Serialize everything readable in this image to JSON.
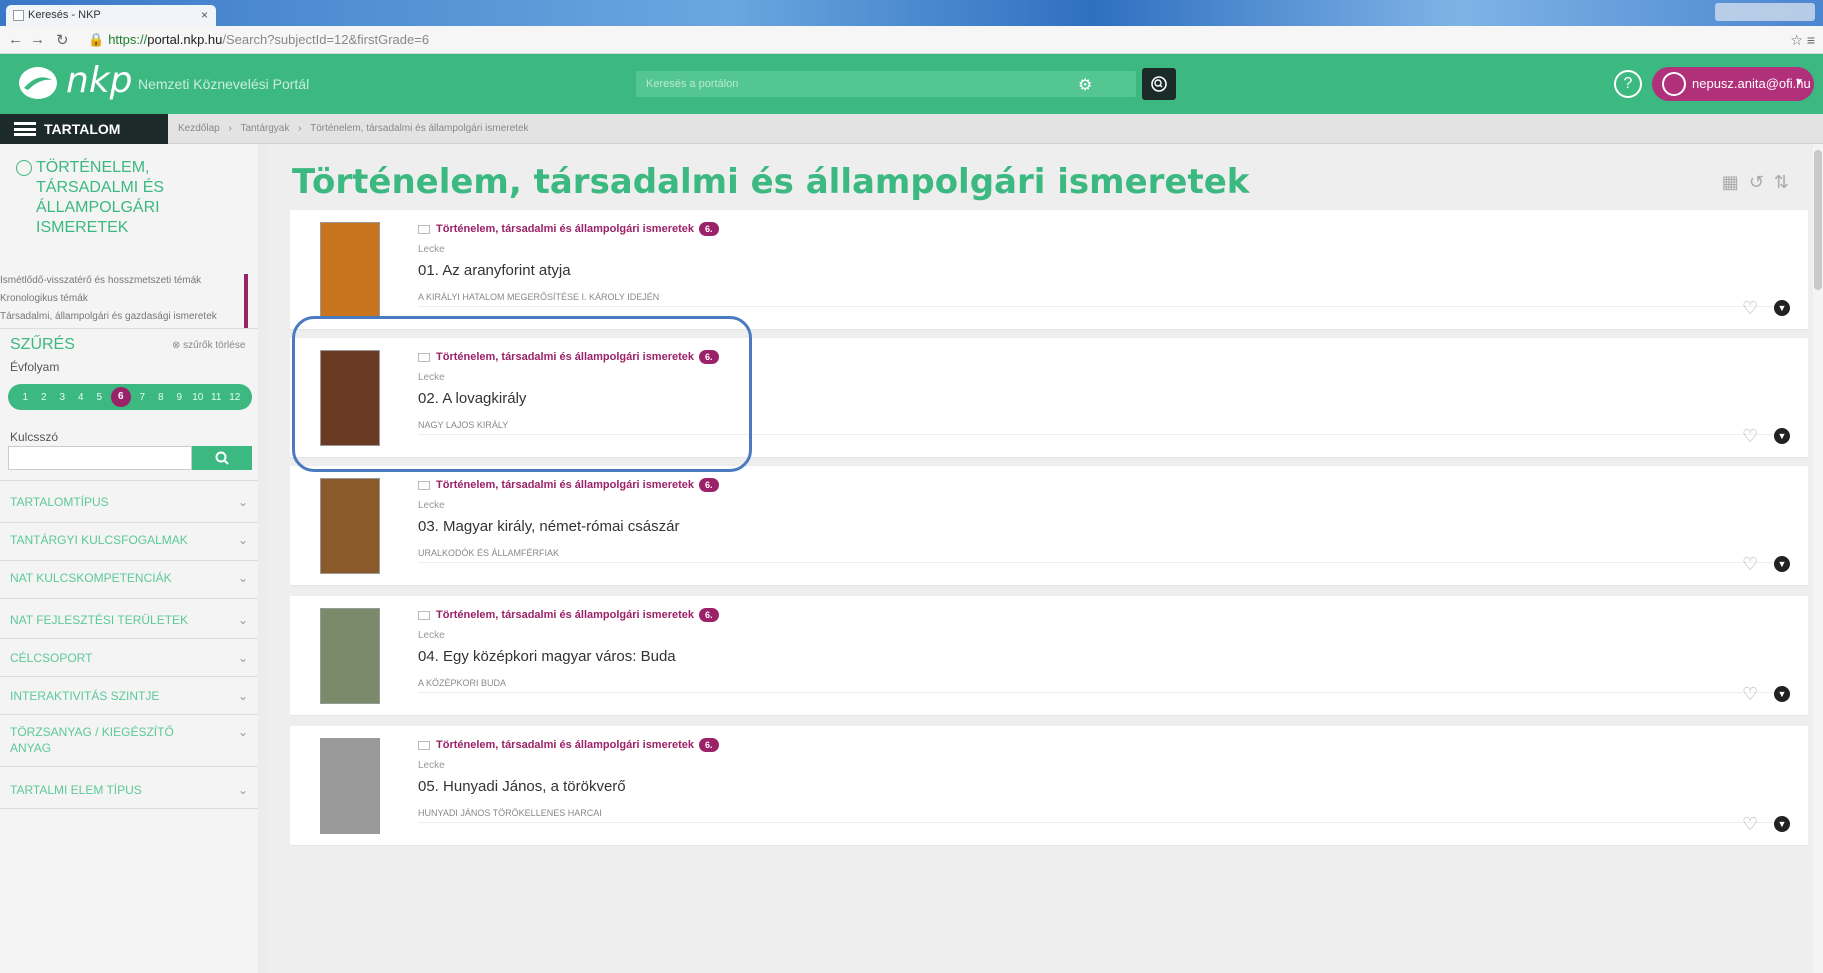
{
  "browser": {
    "tab_title": "Keresés - NKP",
    "tab_close": "×",
    "url_prefix": "https://",
    "url_host": "portal.nkp.hu",
    "url_path": "/Search?subjectId=12&firstGrade=6"
  },
  "header": {
    "logo_text": "nkp",
    "portal_name": "Nemzeti Köznevelési Portál",
    "search_placeholder": "Keresés a portálon",
    "help_symbol": "?",
    "user_email": "nepusz.anita@ofi.hu"
  },
  "menu": {
    "label": "TARTALOM"
  },
  "breadcrumb": [
    "Kezdőlap",
    "›",
    "Tantárgyak",
    "›",
    "Történelem, társadalmi és állampolgári ismeretek"
  ],
  "sidebar": {
    "subject_heading": "Történelem, társadalmi és állampolgári ismeretek",
    "links": [
      "Ismétlődő-visszatérő és hosszmetszeti témák",
      "Kronologikus témák",
      "Társadalmi, állampolgári és gazdasági ismeretek"
    ],
    "filter_title": "SZŰRÉS",
    "filter_clear": "⊗ szűrők törlése",
    "grade_label": "Évfolyam",
    "grades": [
      "1",
      "2",
      "3",
      "4",
      "5",
      "6",
      "7",
      "8",
      "9",
      "10",
      "11",
      "12"
    ],
    "selected_grade": "6",
    "keyword_label": "Kulcsszó",
    "facets": [
      "Tartalomtípus",
      "Tantárgyi kulcsfogalmak",
      "NAT kulcskompetenciák",
      "NAT fejlesztési területek",
      "Célcsoport",
      "Interaktivitás szintje",
      "Törzsanyag / kiegészítő anyag",
      "Tartalmi elem típus"
    ]
  },
  "main": {
    "title": "Történelem, társadalmi és állampolgári ismeretek",
    "cards": [
      {
        "subject": "Történelem, társadalmi és állampolgári ismeretek",
        "grade": "6.",
        "type": "Lecke",
        "title": "01. Az aranyforint atyja",
        "topic": "A királyi hatalom megerősítése I. Károly idején",
        "thumb_color": "#c8741e"
      },
      {
        "subject": "Történelem, társadalmi és állampolgári ismeretek",
        "grade": "6.",
        "type": "Lecke",
        "title": "02. A lovagkirály",
        "topic": "Nagy Lajos király",
        "thumb_color": "#6a3a22"
      },
      {
        "subject": "Történelem, társadalmi és állampolgári ismeretek",
        "grade": "6.",
        "type": "Lecke",
        "title": "03. Magyar király, német-római császár",
        "topic": "Uralkodók és államférfiak",
        "thumb_color": "#8a5a2a"
      },
      {
        "subject": "Történelem, társadalmi és állampolgári ismeretek",
        "grade": "6.",
        "type": "Lecke",
        "title": "04. Egy középkori magyar város: Buda",
        "topic": "A középkori Buda",
        "thumb_color": "#7a8a6a"
      },
      {
        "subject": "Történelem, társadalmi és állampolgári ismeretek",
        "grade": "6.",
        "type": "Lecke",
        "title": "05. Hunyadi János, a törökverő",
        "topic": "Hunyadi János törökellenes harcai",
        "thumb_color": "#9a9a9a"
      }
    ]
  },
  "colors": {
    "brand_green": "#3cb881",
    "accent_purple": "#9b2168",
    "dark": "#1d2a2a"
  }
}
